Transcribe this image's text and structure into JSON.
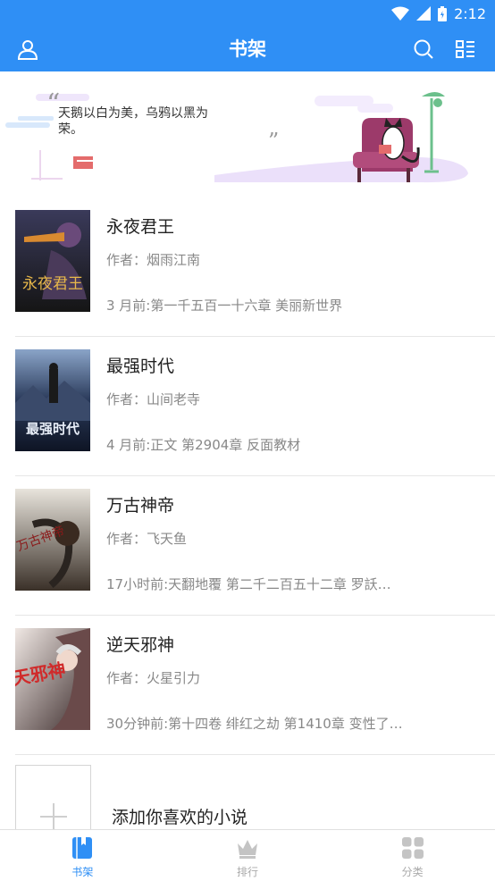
{
  "status_bar": {
    "time": "2:12"
  },
  "app_bar": {
    "title": "书架"
  },
  "banner": {
    "quote": "天鹅以白为美，乌鸦以黑为荣。"
  },
  "books": [
    {
      "title": "永夜君王",
      "author": "作者：烟雨江南",
      "update": "3 月前:第一千五百一十六章 美丽新世界",
      "cover_text": "永夜君王"
    },
    {
      "title": "最强时代",
      "author": "作者：山间老寺",
      "update": "4 月前:正文 第2904章 反面教材",
      "cover_text": "最强时代"
    },
    {
      "title": "万古神帝",
      "author": "作者：飞天鱼",
      "update": "17小时前:天翻地覆 第二千二百五十二章 罗訞…",
      "cover_text": "万古神帝"
    },
    {
      "title": "逆天邪神",
      "author": "作者：火星引力",
      "update": "30分钟前:第十四卷 绯红之劫 第1410章 变性了…",
      "cover_text": "逆天邪神"
    }
  ],
  "add_novel": {
    "label": "添加你喜欢的小说"
  },
  "tabs": [
    {
      "label": "书架",
      "icon": "bookshelf-icon",
      "active": true
    },
    {
      "label": "排行",
      "icon": "crown-icon",
      "active": false
    },
    {
      "label": "分类",
      "icon": "grid-icon",
      "active": false
    }
  ],
  "colors": {
    "primary": "#2f8ff5",
    "text_primary": "#222222",
    "text_secondary": "#888888",
    "divider": "#e6e6e6",
    "tab_inactive": "#aaaaaa"
  }
}
